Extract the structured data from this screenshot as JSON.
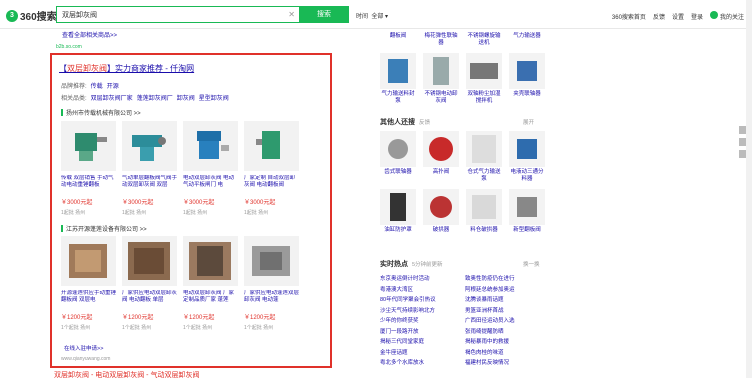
{
  "header": {
    "logo_text": "360搜索",
    "query": "双层卸灰阀",
    "search_btn": "搜索",
    "time_label": "时间",
    "time_value": "全部",
    "links": [
      "360搜索首页",
      "反馈",
      "设置",
      "登录",
      "我的关注"
    ]
  },
  "left": {
    "prev_more": "查看全部相关商品>>",
    "prev_url": "b2b.so.com",
    "ad": {
      "title_prefix": "【",
      "title_kw": "双层卸灰阀",
      "title_rest": "】实力商家推荐 - 仟淘网",
      "brand_label": "品牌推荐:",
      "brands": [
        "传载",
        "开源"
      ],
      "related_label": "相关品类:",
      "related": [
        "双层卸灰阀厂家",
        "蓬莲卸灰阀厂",
        "卸灰阀",
        "星型卸灰阀"
      ],
      "section1": "扬州市传载机械有限公司 >>",
      "prods1": [
        {
          "name": "传载 双层销售 手动气动电动重锤翻板",
          "price": "￥3000元起",
          "meta": "1起批 扬州"
        },
        {
          "name": "气动单层翻板阀气阀手动双层卸灰阀 双层",
          "price": "￥3000元起",
          "meta": "1起批 扬州"
        },
        {
          "name": "电动双层卸灰阀 电动 气动平板闸门 电",
          "price": "￥3000元起",
          "meta": "1起批 扬州"
        },
        {
          "name": "厂家定制 自动双层卸灰阀 电动翻板阀",
          "price": "￥3000元起",
          "meta": "1起批 扬州"
        }
      ],
      "section2": "江苏开源蓬莲设备有限公司 >>",
      "prods2": [
        {
          "name": "开源蓬莲供应手动重锤翻板阀 双层电",
          "price": "￥1200元起",
          "meta": "1个起批 扬州"
        },
        {
          "name": "厂家供应电动双层卸灰阀 电动翻板 单层",
          "price": "￥1200元起",
          "meta": "1个起批 扬州"
        },
        {
          "name": "电动双层卸灰阀 厂家定制品质厂家 蓬莲 ",
          "price": "￥1200元起",
          "meta": "1个起批 扬州"
        },
        {
          "name": "厂家供应电动蓬莲双层卸灰阀 电动蓬",
          "price": "￥1200元起",
          "meta": "1个起批 扬州"
        }
      ],
      "more": "在线入驻申请>>",
      "url": "www.qianyuwang.com"
    },
    "bottom": "双层卸灰阀 - 电动双层卸灰阀 - 气动双层卸灰阀"
  },
  "right": {
    "row1": [
      "翻板阀",
      "梅花弹性联轴器",
      "不锈钢螺旋输送机",
      "气力输送器"
    ],
    "row2": [
      "气力输送料封泵",
      "不锈钢电动卸灰阀",
      "双轴粉尘加湿搅拌机",
      "夹壳联轴器"
    ],
    "also_title": "其他人还搜",
    "also_sub": "反馈",
    "also_toggle": "展开",
    "row3": [
      "齿式联轴器",
      "高扑阀",
      "仓式气力输送泵",
      "电液动三通分料器"
    ],
    "row4": [
      "油缸防护罩",
      "破拱器",
      "料仓破拱器",
      "新型翻板阀"
    ],
    "hot_title": "实时热点",
    "hot_sub": "5分钟前更新",
    "hot_toggle": "换一换",
    "hot": [
      [
        "东京奥运倒计时活动",
        "致奥性防疫仍在进行"
      ],
      [
        "粤港澳大湾区",
        "阿根廷总统参加奥运"
      ],
      [
        "80年代同学聚会引热议",
        "沈腾谈暴雨话题"
      ],
      [
        "沙尘天气持续影响北方",
        "男篮亚洲杯首战"
      ],
      [
        "少年的你终获奖",
        "广西田径运动员入选"
      ],
      [
        "厦门一段路开放",
        "张雨绮提醒防晒"
      ],
      [
        "揭秘三代同堂家庭",
        "揭秘暴雨中的救援"
      ],
      [
        "金牛座话题",
        "褐色肉桂的味道"
      ],
      [
        "粤北多个水库放水",
        "福建村民反映情况"
      ]
    ]
  },
  "colors": {
    "accent": "#19b955",
    "ad_border": "#e0312a",
    "link": "#1a0dab",
    "price": "#e0312a"
  }
}
